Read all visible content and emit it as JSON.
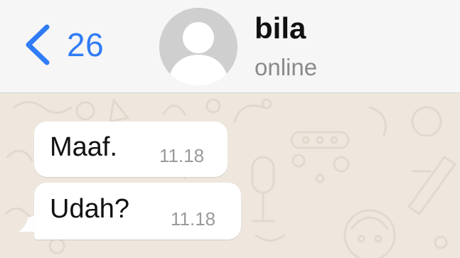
{
  "header": {
    "back_count": "26",
    "contact_name": "bila",
    "contact_status": "online"
  },
  "messages": [
    {
      "text": "Maaf.",
      "time": "11.18"
    },
    {
      "text": "Udah?",
      "time": "11.18"
    }
  ],
  "colors": {
    "accent": "#2f7cf6",
    "header_bg": "#f6f6f6",
    "chat_bg": "#efe7dd",
    "bubble_bg": "#ffffff"
  },
  "icons": {
    "back": "chevron-left-icon",
    "avatar": "person-placeholder-icon"
  }
}
